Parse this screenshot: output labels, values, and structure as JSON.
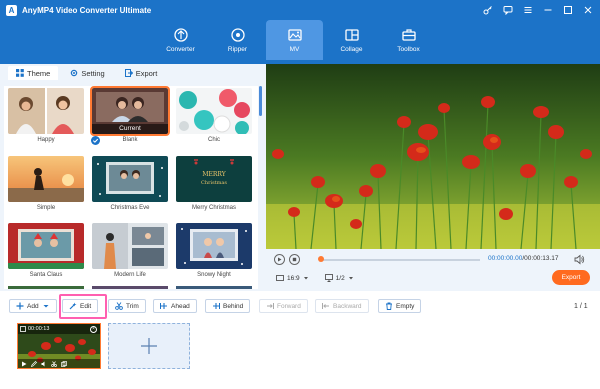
{
  "app": {
    "title": "AnyMP4 Video Converter Ultimate",
    "logo_letter": "A"
  },
  "nav": {
    "tabs": [
      {
        "label": "Converter",
        "icon": "converter-icon",
        "active": false
      },
      {
        "label": "Ripper",
        "icon": "ripper-icon",
        "active": false
      },
      {
        "label": "MV",
        "icon": "mv-icon",
        "active": true
      },
      {
        "label": "Collage",
        "icon": "collage-icon",
        "active": false
      },
      {
        "label": "Toolbox",
        "icon": "toolbox-icon",
        "active": false
      }
    ]
  },
  "panel": {
    "tabs": [
      {
        "label": "Theme",
        "icon": "grid-icon",
        "active": true
      },
      {
        "label": "Setting",
        "icon": "gear-icon",
        "active": false
      },
      {
        "label": "Export",
        "icon": "export-icon",
        "active": false
      }
    ],
    "themes": [
      {
        "label": "Happy"
      },
      {
        "label": "Blank",
        "current": "Current",
        "selected": true
      },
      {
        "label": "Chic"
      },
      {
        "label": "Simple"
      },
      {
        "label": "Christmas Eve"
      },
      {
        "label": "Merry Christmas"
      },
      {
        "label": "Santa Claus"
      },
      {
        "label": "Modern Life"
      },
      {
        "label": "Snowy Night"
      }
    ]
  },
  "player": {
    "time_current": "00:00:00.00",
    "time_separator": "/",
    "time_total": "00:00:13.17",
    "aspect_ratio": "16:9",
    "page": "1/2",
    "export_label": "Export",
    "progress": 0
  },
  "toolbar": {
    "add": "Add",
    "edit": "Edit",
    "trim": "Trim",
    "ahead": "Ahead",
    "behind": "Behind",
    "forward": "Forward",
    "backward": "Backward",
    "empty": "Empty",
    "page_count": "1 / 1"
  },
  "timeline": {
    "clip_duration": "00:00:13"
  },
  "colors": {
    "brand_blue": "#1c73c8",
    "accent_orange": "#ff6a1f",
    "highlight_pink": "#ff5fb0"
  }
}
